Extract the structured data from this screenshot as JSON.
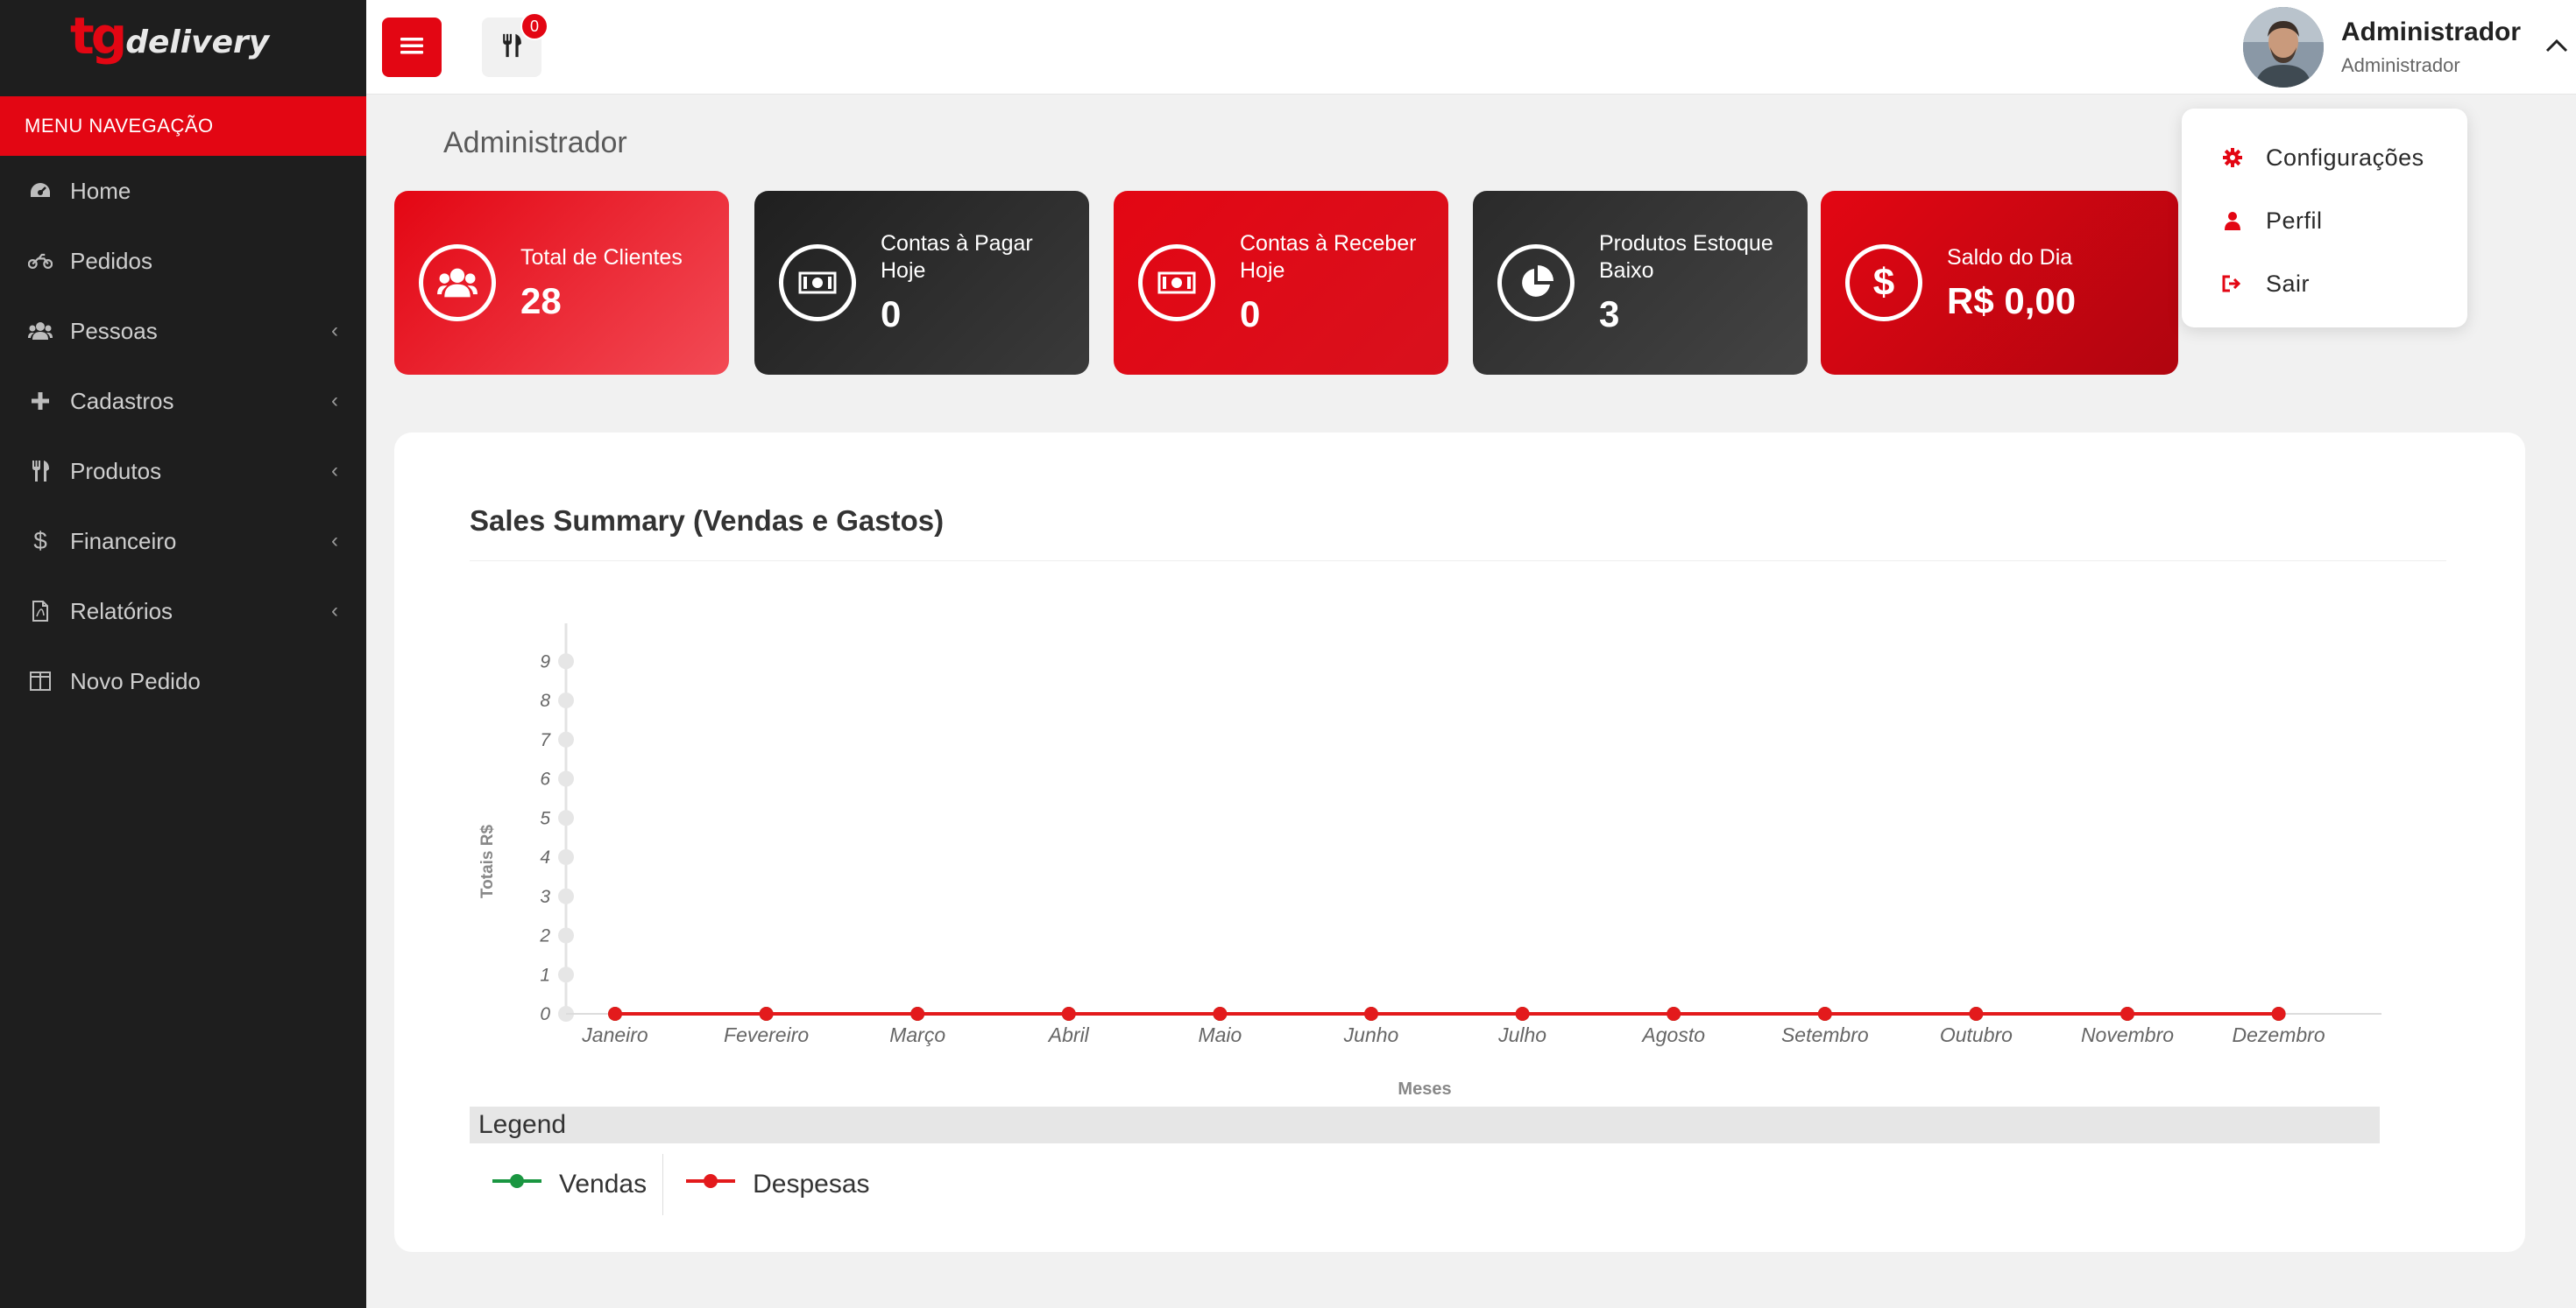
{
  "brand": {
    "logo_tg": "tg",
    "logo_delivery": "delivery",
    "accent": "#e30613"
  },
  "sidebar": {
    "header": "MENU NAVEGAÇÃO",
    "items": [
      {
        "label": "Home",
        "icon": "dashboard-icon",
        "has_submenu": false
      },
      {
        "label": "Pedidos",
        "icon": "motorcycle-icon",
        "has_submenu": false
      },
      {
        "label": "Pessoas",
        "icon": "users-icon",
        "has_submenu": true
      },
      {
        "label": "Cadastros",
        "icon": "plus-icon",
        "has_submenu": true
      },
      {
        "label": "Produtos",
        "icon": "cutlery-icon",
        "has_submenu": true
      },
      {
        "label": "Financeiro",
        "icon": "dollar-icon",
        "has_submenu": true
      },
      {
        "label": "Relatórios",
        "icon": "pdf-file-icon",
        "has_submenu": true
      },
      {
        "label": "Novo Pedido",
        "icon": "columns-icon",
        "has_submenu": false
      }
    ]
  },
  "topbar": {
    "menu_icon": "hamburger-icon",
    "orders_icon": "cutlery-icon",
    "orders_badge": "0",
    "user_name": "Administrador",
    "user_role": "Administrador"
  },
  "user_menu": {
    "items": [
      {
        "label": "Configurações",
        "icon": "gear-icon"
      },
      {
        "label": "Perfil",
        "icon": "user-icon"
      },
      {
        "label": "Sair",
        "icon": "sign-out-icon"
      }
    ]
  },
  "page": {
    "title": "Administrador"
  },
  "cards": [
    {
      "label": "Total de Clientes",
      "value": "28",
      "icon": "users-icon"
    },
    {
      "label": "Contas à Pagar Hoje",
      "value": "0",
      "icon": "money-icon"
    },
    {
      "label": "Contas à Receber Hoje",
      "value": "0",
      "icon": "money-icon"
    },
    {
      "label": "Produtos Estoque Baixo",
      "value": "3",
      "icon": "pie-chart-icon"
    },
    {
      "label": "Saldo do Dia",
      "value": "R$ 0,00",
      "icon": "dollar-icon"
    }
  ],
  "chart_panel": {
    "title": "Sales Summary (Vendas e Gastos)",
    "legend_title": "Legend"
  },
  "chart_data": {
    "type": "line",
    "categories": [
      "Janeiro",
      "Fevereiro",
      "Março",
      "Abril",
      "Maio",
      "Junho",
      "Julho",
      "Agosto",
      "Setembro",
      "Outubro",
      "Novembro",
      "Dezembro"
    ],
    "series": [
      {
        "name": "Vendas",
        "color": "#1a9641",
        "values": [
          0,
          0,
          0,
          0,
          0,
          0,
          0,
          0,
          0,
          0,
          0,
          0
        ]
      },
      {
        "name": "Despesas",
        "color": "#e31a1c",
        "values": [
          0,
          0,
          0,
          0,
          0,
          0,
          0,
          0,
          0,
          0,
          0,
          0
        ]
      }
    ],
    "yticks": [
      "0",
      "1",
      "2",
      "3",
      "4",
      "5",
      "6",
      "7",
      "8",
      "9"
    ],
    "ylim": [
      0,
      9
    ],
    "xlabel": "Meses",
    "ylabel": "Totais R$",
    "grid": false,
    "legend_position": "bottom"
  }
}
